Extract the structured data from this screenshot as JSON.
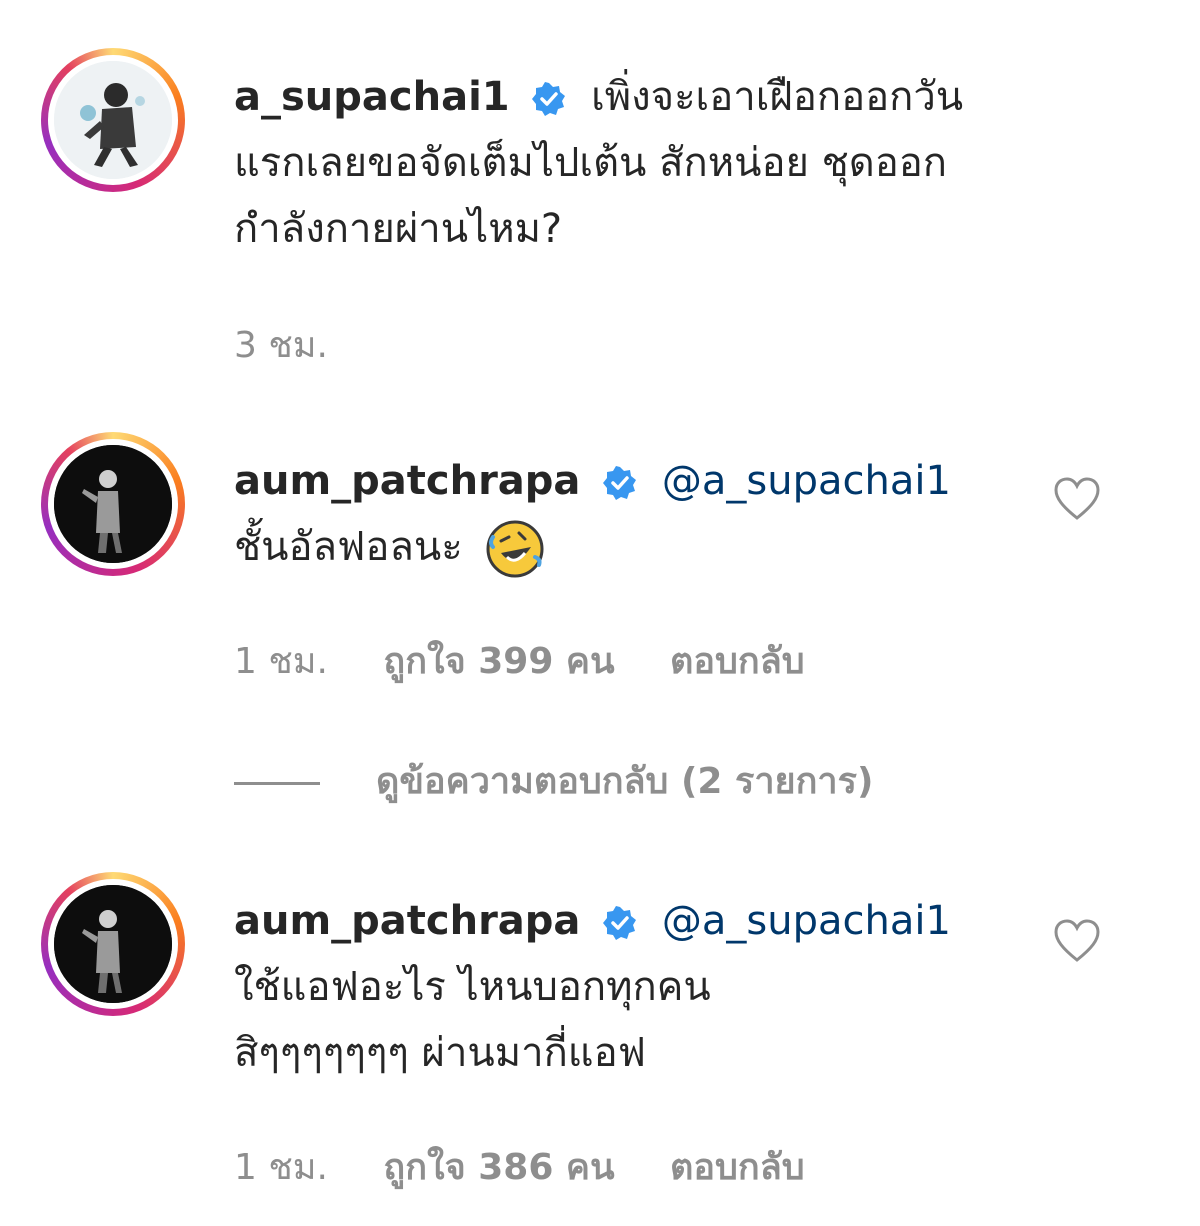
{
  "comments": [
    {
      "username": "a_supachai1",
      "verified": true,
      "text_line1": "เพิ่งจะเอาเฝือกออกวัน",
      "text_line2": "แรกเลยขอจัดเต็มไปเต้น สักหน่อย ชุดออก",
      "text_line3": "กำลังกายผ่านไหม?",
      "time": "3 ชม."
    },
    {
      "username": "aum_patchrapa",
      "verified": true,
      "mention": "@a_supachai1",
      "text_line1": "ชั้นอัลฟอลนะ",
      "emoji": "rolling-on-floor-laughing-emoji",
      "time": "1 ชม.",
      "likes": "ถูกใจ 399 คน",
      "reply": "ตอบกลับ",
      "view_replies": "ดูข้อความตอบกลับ (2 รายการ)"
    },
    {
      "username": "aum_patchrapa",
      "verified": true,
      "mention": "@a_supachai1",
      "text_line1": "ใช้แอฟอะไร ไหนบอกทุกคน",
      "text_line2": "สิๆๆๆๆๆๆๆ ผ่านมากี่แอฟ",
      "time": "1 ชม.",
      "likes": "ถูกใจ 386 คน",
      "reply": "ตอบกลับ"
    }
  ],
  "colors": {
    "text": "#262626",
    "muted": "#8e8e8e",
    "mention": "#00376b",
    "verified": "#3897f0"
  }
}
